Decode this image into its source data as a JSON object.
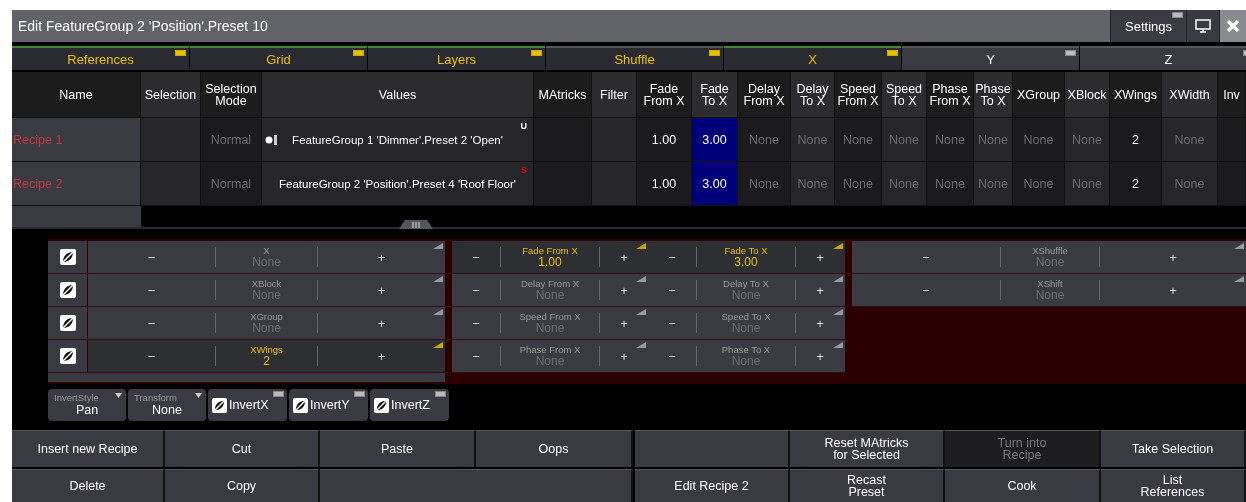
{
  "window": {
    "title": "Edit FeatureGroup 2 'Position'.Preset 10",
    "settings_label": "Settings"
  },
  "tabs": [
    {
      "label": "References",
      "selected": true,
      "active": true
    },
    {
      "label": "Grid",
      "selected": true,
      "active": true
    },
    {
      "label": "Layers",
      "selected": true,
      "active": true
    },
    {
      "label": "Shuffle",
      "selected": false,
      "active": true
    },
    {
      "label": "X",
      "selected": true,
      "active": true
    },
    {
      "label": "Y",
      "selected": false,
      "active": false
    },
    {
      "label": "Z",
      "selected": false,
      "active": false
    }
  ],
  "table": {
    "columns": [
      "Name",
      "Selection",
      "Selection\nMode",
      "Values",
      "MAtricks",
      "Filter",
      "Fade\nFrom X",
      "Fade\nTo X",
      "Delay\nFrom X",
      "Delay\nTo X",
      "Speed\nFrom X",
      "Speed\nTo X",
      "Phase\nFrom X",
      "Phase\nTo X",
      "XGroup",
      "XBlock",
      "XWings",
      "XWidth",
      "Inv"
    ],
    "rows": [
      {
        "name": "Recipe 1",
        "mode": "Normal",
        "values": "FeatureGroup 1 'Dimmer'.Preset 2 'Open'",
        "preset_icon": true,
        "badge": "U",
        "badge_alert": false,
        "settings": [
          {
            "text": "1.00",
            "default": false,
            "selected": false
          },
          {
            "text": "3.00",
            "default": false,
            "selected": true
          },
          {
            "text": "None",
            "default": true,
            "selected": false
          },
          {
            "text": "None",
            "default": true,
            "selected": false
          },
          {
            "text": "None",
            "default": true,
            "selected": false
          },
          {
            "text": "None",
            "default": true,
            "selected": false
          },
          {
            "text": "None",
            "default": true,
            "selected": false
          },
          {
            "text": "None",
            "default": true,
            "selected": false
          },
          {
            "text": "None",
            "default": true,
            "selected": false
          },
          {
            "text": "None",
            "default": true,
            "selected": false
          },
          {
            "text": "2",
            "default": false,
            "selected": false
          },
          {
            "text": "None",
            "default": true,
            "selected": false
          }
        ]
      },
      {
        "name": "Recipe 2",
        "mode": "Normal",
        "values": "FeatureGroup 2 'Position'.Preset 4 'Roof Floor'",
        "preset_icon": false,
        "badge": "S",
        "badge_alert": true,
        "settings": [
          {
            "text": "1.00",
            "default": false,
            "selected": false
          },
          {
            "text": "3.00",
            "default": false,
            "selected": true
          },
          {
            "text": "None",
            "default": true,
            "selected": false
          },
          {
            "text": "None",
            "default": true,
            "selected": false
          },
          {
            "text": "None",
            "default": true,
            "selected": false
          },
          {
            "text": "None",
            "default": true,
            "selected": false
          },
          {
            "text": "None",
            "default": true,
            "selected": false
          },
          {
            "text": "None",
            "default": true,
            "selected": false
          },
          {
            "text": "None",
            "default": true,
            "selected": false
          },
          {
            "text": "None",
            "default": true,
            "selected": false
          },
          {
            "text": "2",
            "default": false,
            "selected": false
          },
          {
            "text": "None",
            "default": true,
            "selected": false
          }
        ]
      }
    ]
  },
  "encoders": {
    "left": [
      {
        "label": "X",
        "value": "None",
        "active": false
      },
      {
        "label": "XBlock",
        "value": "None",
        "active": false
      },
      {
        "label": "XGroup",
        "value": "None",
        "active": false
      },
      {
        "label": "XWings",
        "value": "2",
        "active": true
      }
    ],
    "middle": [
      {
        "label": "Fade From X",
        "value": "1.00",
        "active": true
      },
      {
        "label": "Fade To X",
        "value": "3.00",
        "active": true
      },
      {
        "label": "Delay From X",
        "value": "None",
        "active": false
      },
      {
        "label": "Delay To X",
        "value": "None",
        "active": false
      },
      {
        "label": "Speed From X",
        "value": "None",
        "active": false
      },
      {
        "label": "Speed To X",
        "value": "None",
        "active": false
      },
      {
        "label": "Phase From X",
        "value": "None",
        "active": false
      },
      {
        "label": "Phase To X",
        "value": "None",
        "active": false
      }
    ],
    "right": [
      {
        "label": "XShuffle",
        "value": "None",
        "active": false
      },
      {
        "label": "XShift",
        "value": "None",
        "active": false
      }
    ],
    "minus": "−",
    "plus": "+"
  },
  "options": [
    {
      "kind": "select",
      "label": "InvertStyle",
      "value": "Pan"
    },
    {
      "kind": "select",
      "label": "Transform",
      "value": "None"
    },
    {
      "kind": "toggle",
      "label": "InvertX"
    },
    {
      "kind": "toggle",
      "label": "InvertY"
    },
    {
      "kind": "toggle",
      "label": "InvertZ"
    }
  ],
  "buttons": [
    [
      {
        "kind": "button",
        "label": "Insert new Recipe",
        "disabled": false
      },
      {
        "kind": "button",
        "label": "Cut",
        "disabled": false
      },
      {
        "kind": "button",
        "label": "Paste",
        "disabled": false
      },
      {
        "kind": "button",
        "label": "Oops",
        "disabled": false
      },
      {
        "kind": "blank"
      },
      {
        "kind": "button",
        "label": "Reset MAtricks\nfor Selected",
        "disabled": false
      },
      {
        "kind": "button",
        "label": "Turn into\nRecipe",
        "disabled": true
      },
      {
        "kind": "button",
        "label": "Take Selection",
        "disabled": false
      }
    ],
    [
      {
        "kind": "button",
        "label": "Delete",
        "disabled": false
      },
      {
        "kind": "button",
        "label": "Copy",
        "disabled": false
      },
      {
        "kind": "wide_blank"
      },
      {
        "kind": "button",
        "label": "Edit Recipe 2",
        "disabled": false
      },
      {
        "kind": "button",
        "label": "Recast\nPreset",
        "disabled": false
      },
      {
        "kind": "button",
        "label": "Cook",
        "disabled": false
      },
      {
        "kind": "button",
        "label": "List\nReferences",
        "disabled": false
      }
    ]
  ]
}
